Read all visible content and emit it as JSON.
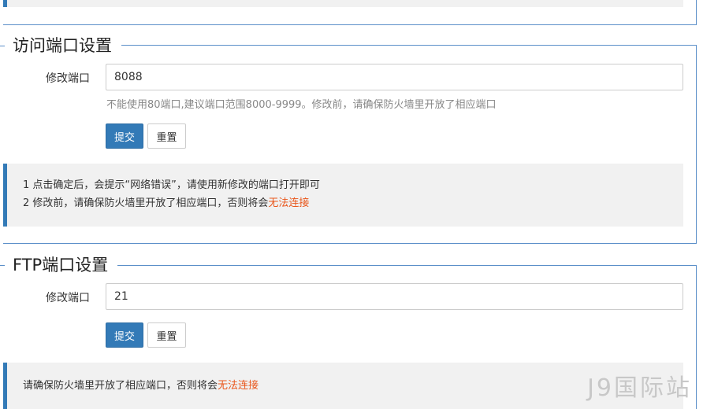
{
  "access_port": {
    "title": "访问端口设置",
    "field_label": "修改端口",
    "port_value": "8088",
    "help_text": "不能使用80端口,建议端口范围8000-9999。修改前，请确保防火墙里开放了相应端口",
    "submit_label": "提交",
    "reset_label": "重置",
    "notice_line1": "1 点击确定后，会提示“网络错误”，请使用新修改的端口打开即可",
    "notice_line2_prefix": "2 修改前，请确保防火墙里开放了相应端口，否则将会",
    "notice_line2_warn": "无法连接"
  },
  "ftp_port": {
    "title": "FTP端口设置",
    "field_label": "修改端口",
    "port_value": "21",
    "submit_label": "提交",
    "reset_label": "重置",
    "notice_prefix": "请确保防火墙里开放了相应端口，否则将会",
    "notice_warn": "无法连接"
  },
  "watermark": "J9国际站",
  "colors": {
    "accent": "#337ab7",
    "border": "#5b8fc9",
    "warning": "#e9561b",
    "notice_bg": "#f1f1f1"
  }
}
